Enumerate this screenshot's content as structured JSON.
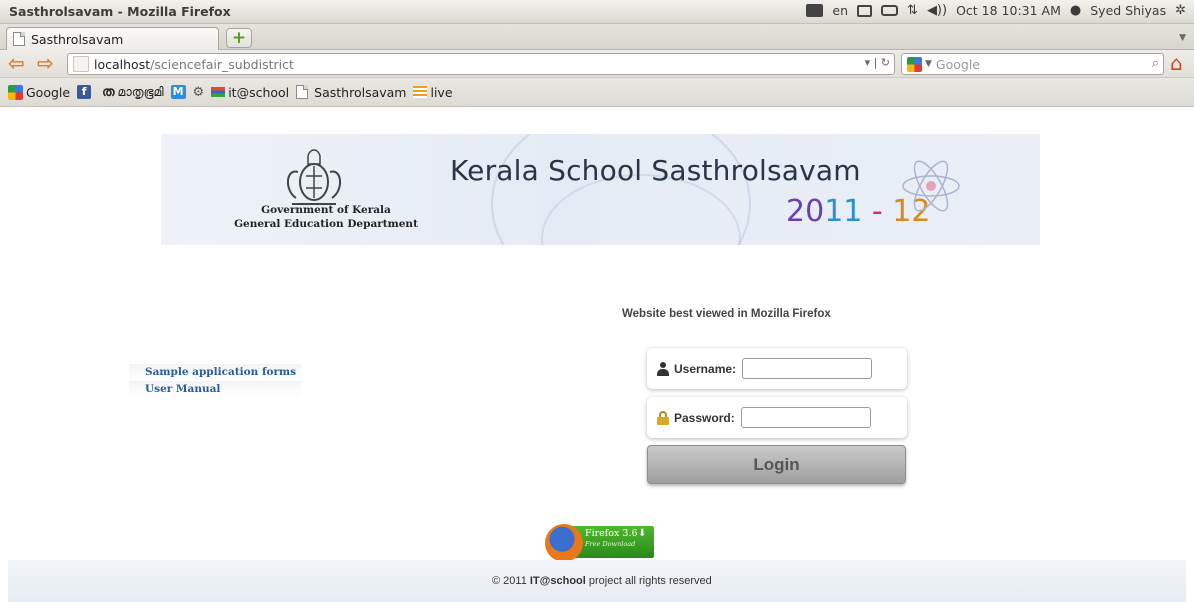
{
  "window": {
    "title": "Sasthrolsavam - Mozilla Firefox"
  },
  "system_tray": {
    "keyboard_layout": "en",
    "icons": [
      "keyboard-icon",
      "mail-icon",
      "battery-icon",
      "network-icon",
      "volume-icon",
      "user-icon",
      "settings-icon"
    ],
    "datetime": "Oct 18 10:31 AM",
    "user": "Syed Shiyas"
  },
  "tabs": [
    {
      "label": "Sasthrolsavam",
      "active": true
    }
  ],
  "navigation": {
    "url_host": "localhost",
    "url_path": "/sciencefair_subdistrict",
    "search_placeholder": "Google"
  },
  "bookmarks": [
    {
      "label": "Google",
      "icon": "google-icon"
    },
    {
      "label": "",
      "icon": "facebook-icon"
    },
    {
      "label": "മാതൃഭൂമി",
      "icon": "mathrubhumi-icon"
    },
    {
      "label": "",
      "icon": "gmail-icon"
    },
    {
      "label": "",
      "icon": "gear-icon"
    },
    {
      "label": "it@school",
      "icon": "itschool-icon"
    },
    {
      "label": "Sasthrolsavam",
      "icon": "page-icon"
    },
    {
      "label": "live",
      "icon": "live-icon"
    }
  ],
  "banner": {
    "gov_line1": "Government of Kerala",
    "gov_line2": "General Education Department",
    "title": "Kerala School Sasthrolsavam",
    "year_parts": [
      "20",
      "11",
      " - ",
      "12"
    ]
  },
  "best_viewed": "Website best viewed in Mozilla Firefox",
  "side_links": [
    "Sample application forms",
    "User Manual"
  ],
  "login": {
    "username_label": "Username:",
    "password_label": "Password:",
    "button_label": "Login",
    "username_value": "",
    "password_value": ""
  },
  "firefox_badge": {
    "title": "Firefox 3.6",
    "subtitle": "Free Download"
  },
  "footer": {
    "prefix": "© 2011 ",
    "brand": "IT@school",
    "suffix": " project all rights reserved"
  },
  "colors": {
    "nav_arrow": "#e8761a",
    "link": "#2a5b9a",
    "login_button": "#b0b0b0",
    "year_20": "#6a3fb0",
    "year_11": "#2a8fd4",
    "year_dash": "#d42a6a",
    "year_12": "#d8891c"
  }
}
